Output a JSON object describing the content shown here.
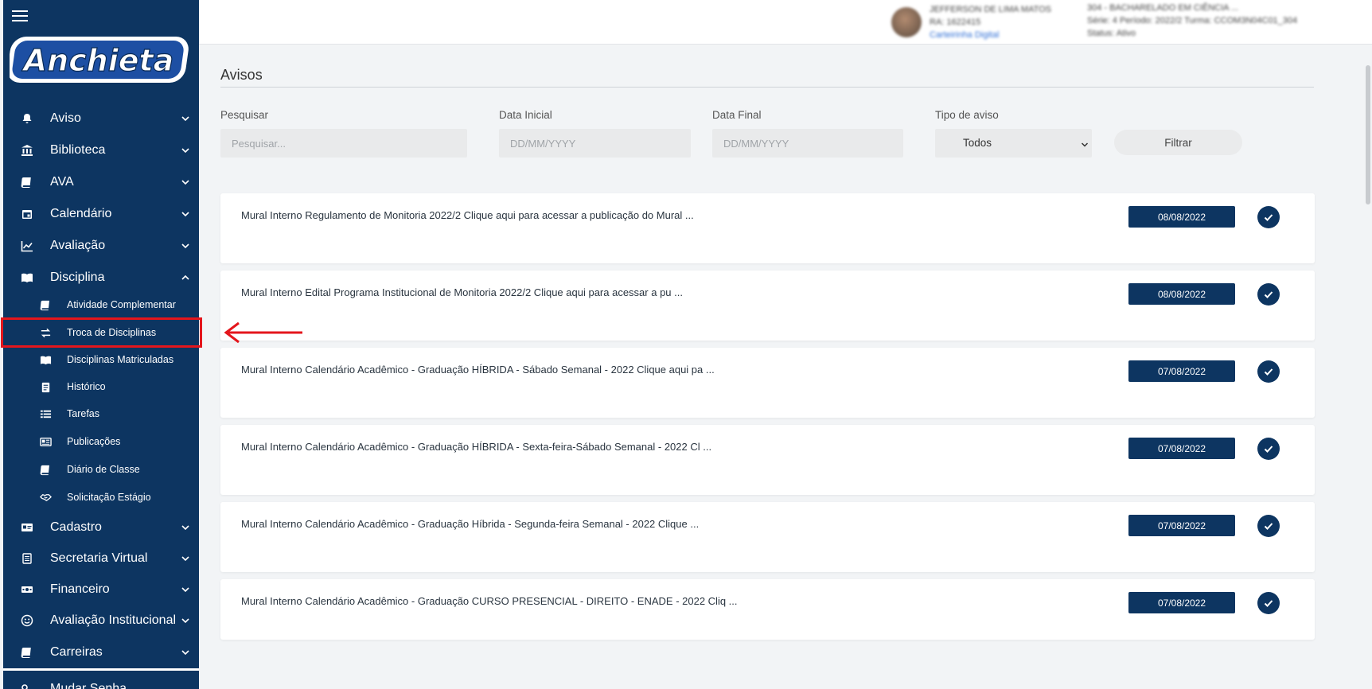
{
  "app": {
    "logo_text": "Anchieta",
    "brand_color": "#0d3561",
    "highlight_color": "#e4161c"
  },
  "topbar": {
    "profile": {
      "name": "JEFFERSON DE LIMA MATOS",
      "ra": "RA: 1622415",
      "link": "Carteirinha Digital",
      "course": "304 - BACHARELADO EM CIÊNCIA ...",
      "series": "Série: 4 Período: 2022/2 Turma: CCOM3N04C01_304",
      "status": "Status: Ativo"
    }
  },
  "sidebar": {
    "menu": [
      {
        "label": "Aviso",
        "icon": "bell-icon",
        "expanded": false
      },
      {
        "label": "Biblioteca",
        "icon": "bank-icon",
        "expanded": false
      },
      {
        "label": "AVA",
        "icon": "book-icon",
        "expanded": false
      },
      {
        "label": "Calendário",
        "icon": "calendar-icon",
        "expanded": false
      },
      {
        "label": "Avaliação",
        "icon": "chart-line-icon",
        "expanded": false
      },
      {
        "label": "Disciplina",
        "icon": "open-book-icon",
        "expanded": true
      }
    ],
    "submenu": [
      {
        "label": "Atividade Complementar",
        "icon": "book-icon"
      },
      {
        "label": "Troca de Disciplinas",
        "icon": "exchange-icon",
        "highlighted": true
      },
      {
        "label": "Disciplinas Matriculadas",
        "icon": "open-book-icon"
      },
      {
        "label": "Histórico",
        "icon": "clipboard-icon"
      },
      {
        "label": "Tarefas",
        "icon": "list-icon"
      },
      {
        "label": "Publicações",
        "icon": "newspaper-icon"
      },
      {
        "label": "Diário de Classe",
        "icon": "book-icon"
      },
      {
        "label": "Solicitação Estágio",
        "icon": "handshake-icon"
      }
    ],
    "menu_bottom": [
      {
        "label": "Cadastro",
        "icon": "id-card-icon"
      },
      {
        "label": "Secretaria Virtual",
        "icon": "document-icon"
      },
      {
        "label": "Financeiro",
        "icon": "money-icon"
      },
      {
        "label": "Avaliação Institucional",
        "icon": "smile-icon"
      },
      {
        "label": "Carreiras",
        "icon": "book-icon"
      }
    ],
    "footer_item": {
      "label": "Mudar Senha",
      "icon": "key-icon"
    }
  },
  "main": {
    "title": "Avisos",
    "filters": {
      "search_label": "Pesquisar",
      "search_placeholder": "Pesquisar...",
      "start_label": "Data Inicial",
      "start_placeholder": "DD/MM/YYYY",
      "end_label": "Data Final",
      "end_placeholder": "DD/MM/YYYY",
      "type_label": "Tipo de aviso",
      "type_value": "Todos",
      "filter_button": "Filtrar"
    },
    "notices": [
      {
        "text": "Mural Interno Regulamento de Monitoria 2022/2 Clique aqui para acessar a publicação do Mural ...",
        "date": "08/08/2022"
      },
      {
        "text": "Mural Interno Edital Programa Institucional de Monitoria 2022/2 Clique aqui para acessar a pu ...",
        "date": "08/08/2022"
      },
      {
        "text": "Mural Interno Calendário Acadêmico - Graduação HÍBRIDA - Sábado Semanal - 2022 Clique aqui pa ...",
        "date": "07/08/2022"
      },
      {
        "text": "Mural Interno Calendário Acadêmico - Graduação HÍBRIDA - Sexta-feira-Sábado Semanal - 2022 Cl ...",
        "date": "07/08/2022"
      },
      {
        "text": "Mural Interno Calendário Acadêmico - Graduação Híbrida - Segunda-feira Semanal - 2022 Clique ...",
        "date": "07/08/2022"
      },
      {
        "text": "Mural Interno Calendário Acadêmico - Graduação CURSO PRESENCIAL - DIREITO - ENADE - 2022 Cliq ...",
        "date": "07/08/2022"
      }
    ]
  }
}
